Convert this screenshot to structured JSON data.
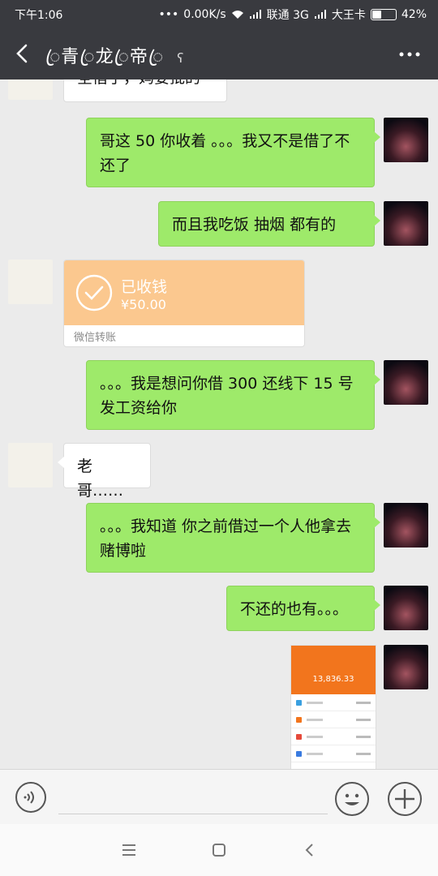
{
  "status_bar": {
    "time": "下午1:06",
    "network_speed": "0.00K/s",
    "carrier1": "联通 3G",
    "carrier2": "大王卡",
    "battery": "42%"
  },
  "header": {
    "title": "ꦿ青ꦿ龙ꦿ帝ꦿ",
    "mute_icon": "ear-icon"
  },
  "messages": [
    {
      "sender": "other",
      "type": "text",
      "text": "全借了，妈要批的"
    },
    {
      "sender": "me",
      "type": "text",
      "text": "哥这 50 你收着 。。。我又不是借了不还了"
    },
    {
      "sender": "me",
      "type": "text",
      "text": "而且我吃饭 抽烟 都有的"
    },
    {
      "sender": "other",
      "type": "transfer",
      "status": "已收钱",
      "amount": "¥50.00",
      "footer": "微信转账"
    },
    {
      "sender": "me",
      "type": "text",
      "text": "。。。我是想问你借 300 还线下 15 号发工资给你"
    },
    {
      "sender": "other",
      "type": "text",
      "text": "老哥……"
    },
    {
      "sender": "me",
      "type": "text",
      "text": "。。。我知道 你之前借过一个人他拿去赌博啦"
    },
    {
      "sender": "me",
      "type": "text",
      "text": "不还的也有。。。"
    },
    {
      "sender": "me",
      "type": "image",
      "text": "13,836.33"
    }
  ],
  "colors": {
    "header_bg": "#393a3f",
    "chat_bg": "#ebebeb",
    "my_bubble": "#9eea6a",
    "their_bubble": "#ffffff",
    "transfer_bg": "#fbc88f",
    "screenshot_accent": "#f2751d"
  }
}
